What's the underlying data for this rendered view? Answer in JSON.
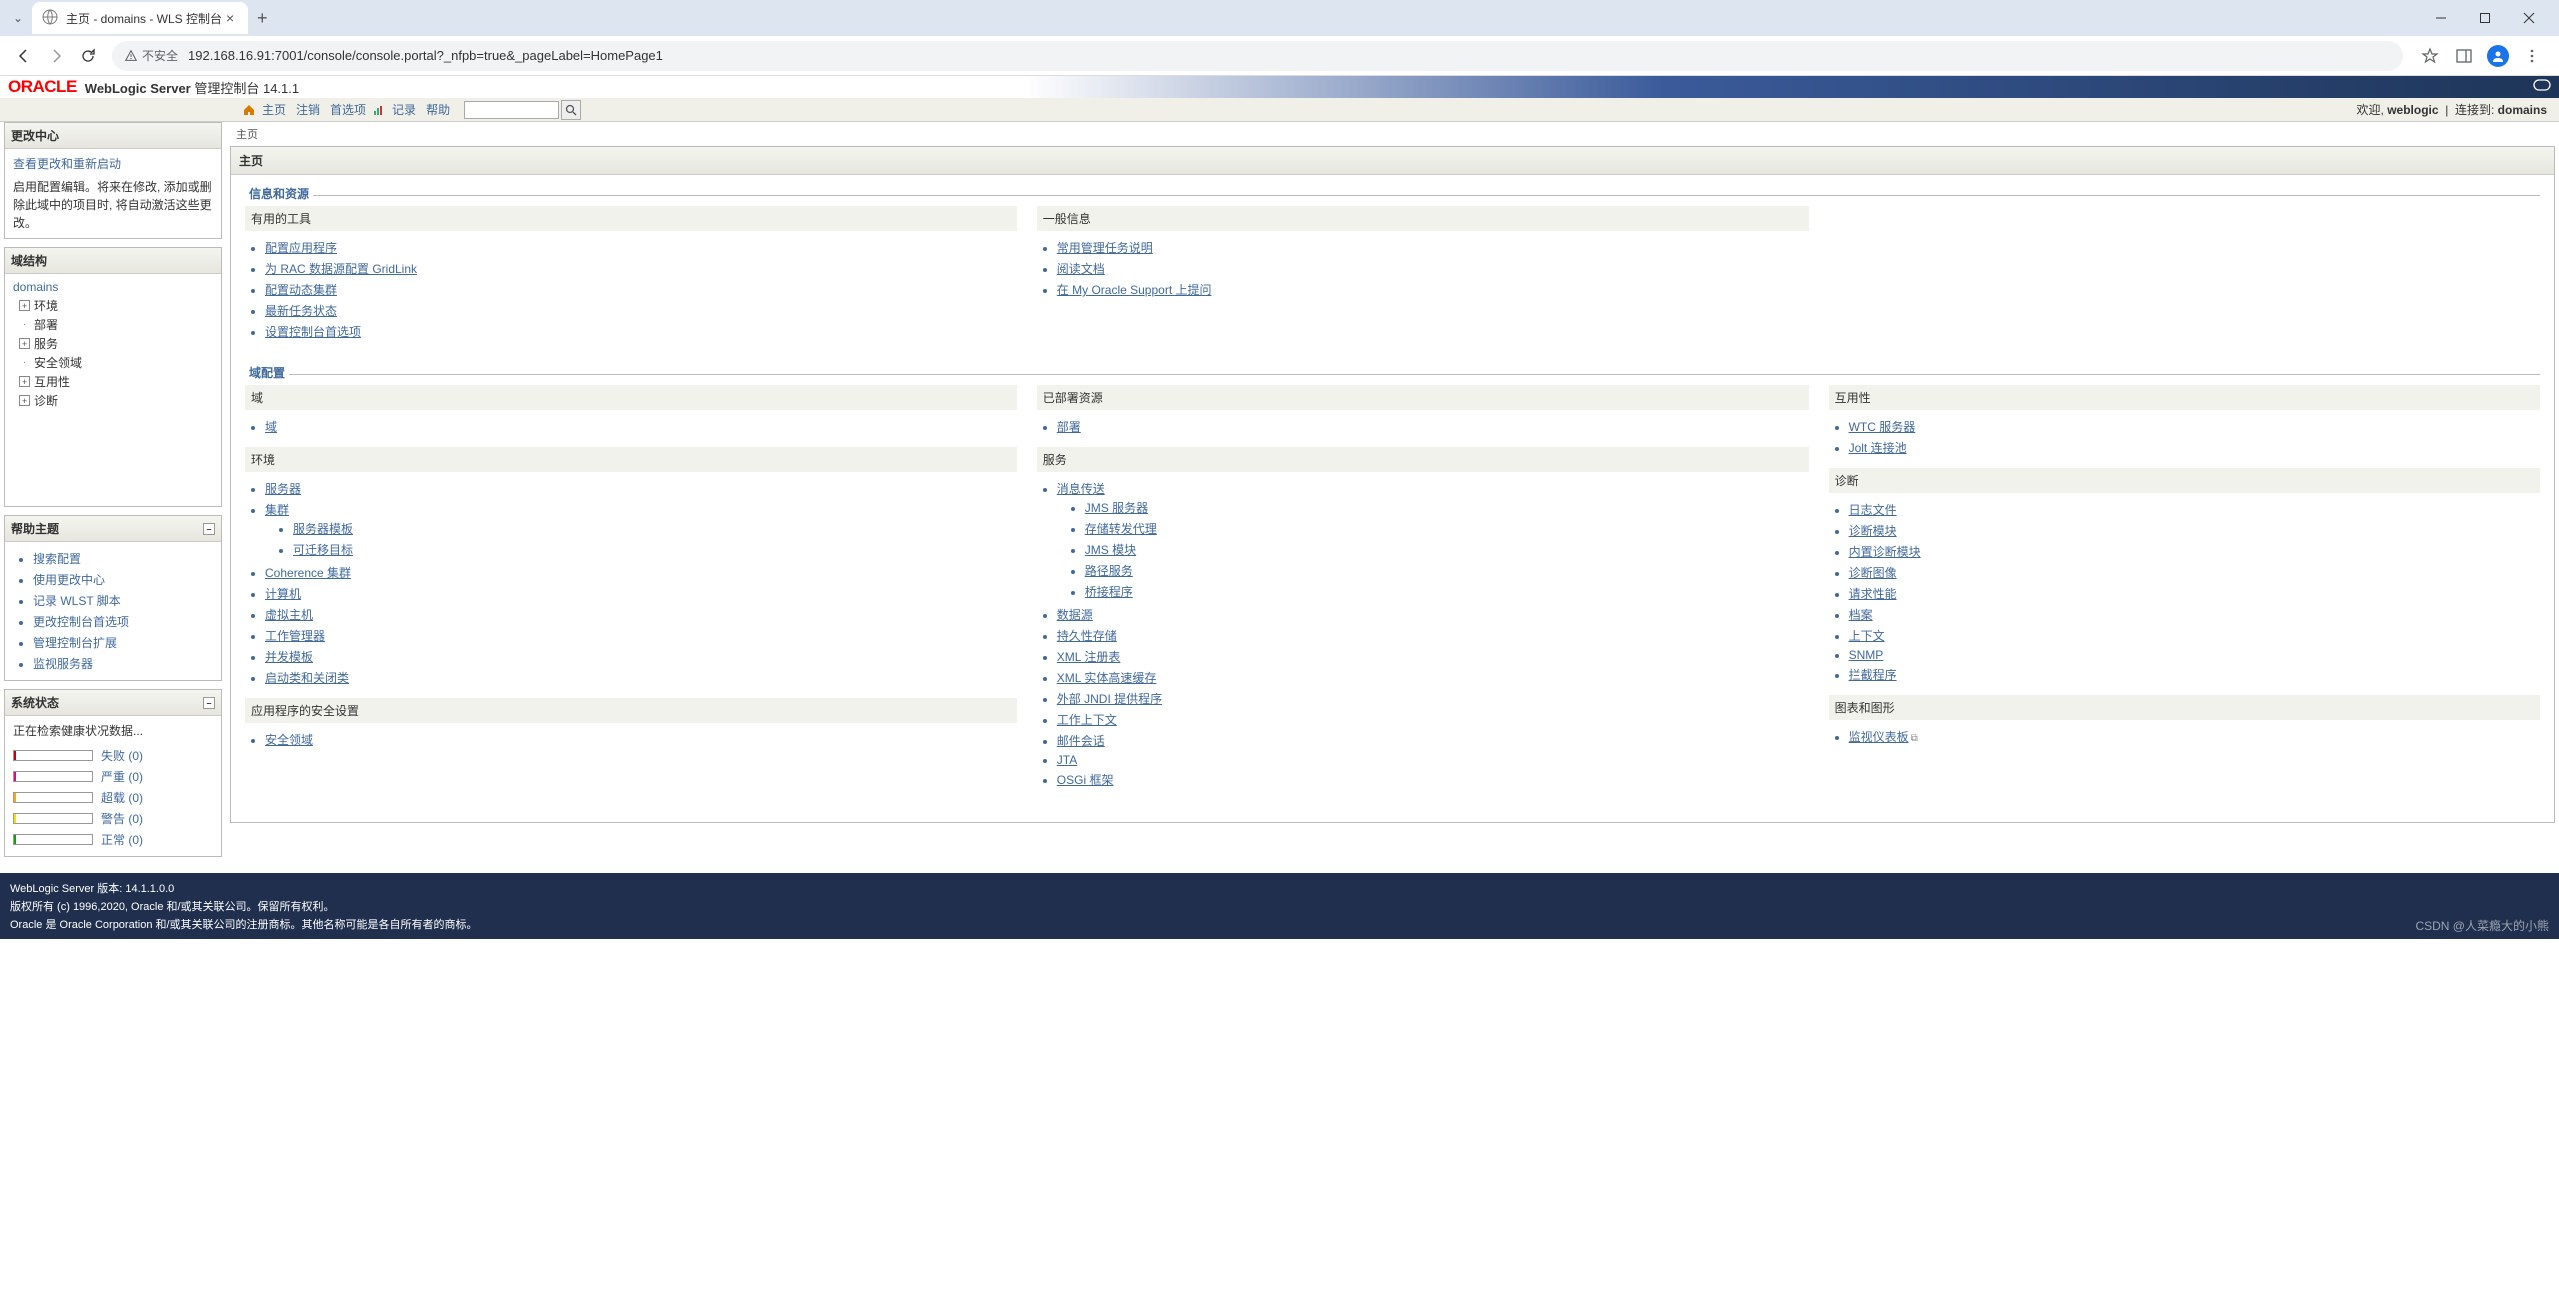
{
  "browser": {
    "tab_title": "主页 - domains - WLS 控制台",
    "tab_close": "×",
    "tab_add": "+",
    "url_security": "不安全",
    "url": "192.168.16.91:7001/console/console.portal?_nfpb=true&_pageLabel=HomePage1"
  },
  "header": {
    "logo": "ORACLE",
    "product_strong": "WebLogic Server",
    "product_rest": " 管理控制台 14.1.1"
  },
  "topnav": {
    "home": "主页",
    "logout": "注销",
    "preferences": "首选项",
    "record": "记录",
    "help": "帮助",
    "search_placeholder": "",
    "welcome_prefix": "欢迎, ",
    "welcome_user": "weblogic",
    "connected_prefix": "连接到: ",
    "connected_to": "domains"
  },
  "breadcrumb": {
    "text": "主页"
  },
  "sidebar": {
    "change_center": {
      "title": "更改中心",
      "link": "查看更改和重新启动",
      "desc": "启用配置编辑。将来在修改, 添加或删除此域中的项目时, 将自动激活这些更改。"
    },
    "domain_structure": {
      "title": "域结构",
      "root": "domains",
      "nodes": [
        {
          "label": "环境",
          "expand": true
        },
        {
          "label": "部署",
          "expand": false
        },
        {
          "label": "服务",
          "expand": true
        },
        {
          "label": "安全领域",
          "expand": false
        },
        {
          "label": "互用性",
          "expand": true
        },
        {
          "label": "诊断",
          "expand": true
        }
      ]
    },
    "help": {
      "title": "帮助主题",
      "items": [
        "搜索配置",
        "使用更改中心",
        "记录 WLST 脚本",
        "更改控制台首选项",
        "管理控制台扩展",
        "监视服务器"
      ]
    },
    "system_status": {
      "title": "系统状态",
      "loading": "正在检索健康状况数据...",
      "rows": [
        {
          "label": "失败 (0)",
          "cls": "status-fail"
        },
        {
          "label": "严重 (0)",
          "cls": "status-crit"
        },
        {
          "label": "超载 (0)",
          "cls": "status-over"
        },
        {
          "label": "警告 (0)",
          "cls": "status-warn"
        },
        {
          "label": "正常 (0)",
          "cls": "status-ok"
        }
      ]
    }
  },
  "main": {
    "title": "主页",
    "info_section": {
      "legend": "信息和资源",
      "left_head": "有用的工具",
      "left_items": [
        "配置应用程序",
        "为 RAC 数据源配置 GridLink",
        "配置动态集群",
        "最新任务状态",
        "设置控制台首选项"
      ],
      "right_head": "一般信息",
      "right_items": [
        "常用管理任务说明",
        "阅读文档",
        "在 My Oracle Support 上提问"
      ]
    },
    "domain_section": {
      "legend": "域配置",
      "col1_a_head": "域",
      "col1_a_items": [
        "域"
      ],
      "col1_b_head": "环境",
      "col1_b_items": [
        "服务器",
        {
          "label": "集群",
          "children": [
            "服务器模板",
            "可迁移目标"
          ]
        },
        "Coherence 集群",
        "计算机",
        "虚拟主机",
        "工作管理器",
        "并发模板",
        "启动类和关闭类"
      ],
      "col1_c_head": "应用程序的安全设置",
      "col1_c_items": [
        "安全领域"
      ],
      "col2_a_head": "已部署资源",
      "col2_a_items": [
        "部署"
      ],
      "col2_b_head": "服务",
      "col2_b_items": [
        {
          "label": "消息传送",
          "children": [
            "JMS 服务器",
            "存储转发代理",
            "JMS 模块",
            "路径服务",
            "桥接程序"
          ]
        },
        "数据源",
        "持久性存储",
        "XML 注册表",
        "XML 实体高速缓存",
        "外部 JNDI 提供程序",
        "工作上下文",
        "邮件会话",
        "JTA",
        "OSGi 框架"
      ],
      "col3_a_head": "互用性",
      "col3_a_items": [
        "WTC 服务器",
        "Jolt 连接池"
      ],
      "col3_b_head": "诊断",
      "col3_b_items": [
        "日志文件",
        "诊断模块",
        "内置诊断模块",
        "诊断图像",
        "请求性能",
        "档案",
        "上下文",
        "SNMP",
        "拦截程序"
      ],
      "col3_c_head": "图表和图形",
      "col3_c_items": [
        "监视仪表板"
      ]
    }
  },
  "footer": {
    "line1": "WebLogic Server 版本: 14.1.1.0.0",
    "line2": "版权所有 (c) 1996,2020, Oracle 和/或其关联公司。保留所有权利。",
    "line3": "Oracle 是 Oracle Corporation 和/或其关联公司的注册商标。其他名称可能是各自所有者的商标。",
    "watermark": "CSDN @人菜瘾大的小熊"
  }
}
